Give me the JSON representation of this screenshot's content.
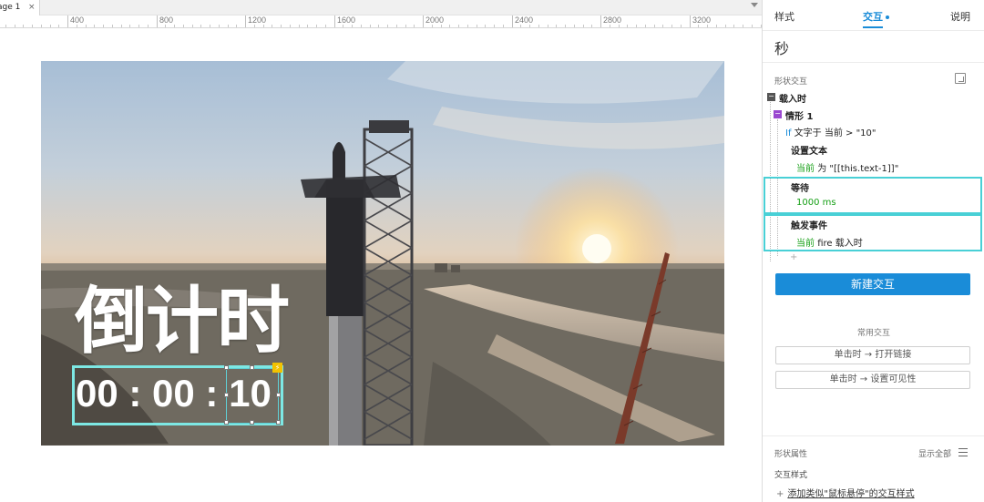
{
  "canvas": {
    "tab_label": "age 1",
    "tab_close": "×",
    "ruler_labels": [
      "400",
      "800",
      "1200",
      "1600",
      "2000",
      "2400",
      "2800",
      "3200"
    ],
    "overlay_title": "倒计时",
    "timer_text": "00 : 00 : 10"
  },
  "panel": {
    "tabs": {
      "style": "样式",
      "interaction": "交互",
      "notes": "说明"
    },
    "shape_name": "秒",
    "section_label": "形状交互",
    "event_label": "载入时",
    "case_label": "情形 1",
    "condition_if": "If",
    "condition_text": "文字于 当前 > \"10\"",
    "actions": [
      {
        "title": "设置文本",
        "target": "当前",
        "detail": "为 \"[[this.text-1]]\""
      },
      {
        "title": "等待",
        "target": "",
        "detail": "1000 ms"
      },
      {
        "title": "触发事件",
        "target": "当前",
        "detail": "fire 载入时"
      }
    ],
    "add_action": "+",
    "new_interaction_button": "新建交互",
    "common_label": "常用交互",
    "common_buttons": [
      "单击时 → 打开链接",
      "单击时 → 设置可见性"
    ],
    "props_label": "形状属性",
    "show_all": "显示全部",
    "interaction_style_label": "交互样式",
    "add_style_plus": "+",
    "add_style_link": "添加类似\"鼠标悬停\"的交互样式"
  },
  "colors": {
    "accent_blue": "#1a8cd8",
    "highlight_cyan": "#49d0d6",
    "action_green": "#18a018",
    "badge_yellow": "#f2c200"
  }
}
